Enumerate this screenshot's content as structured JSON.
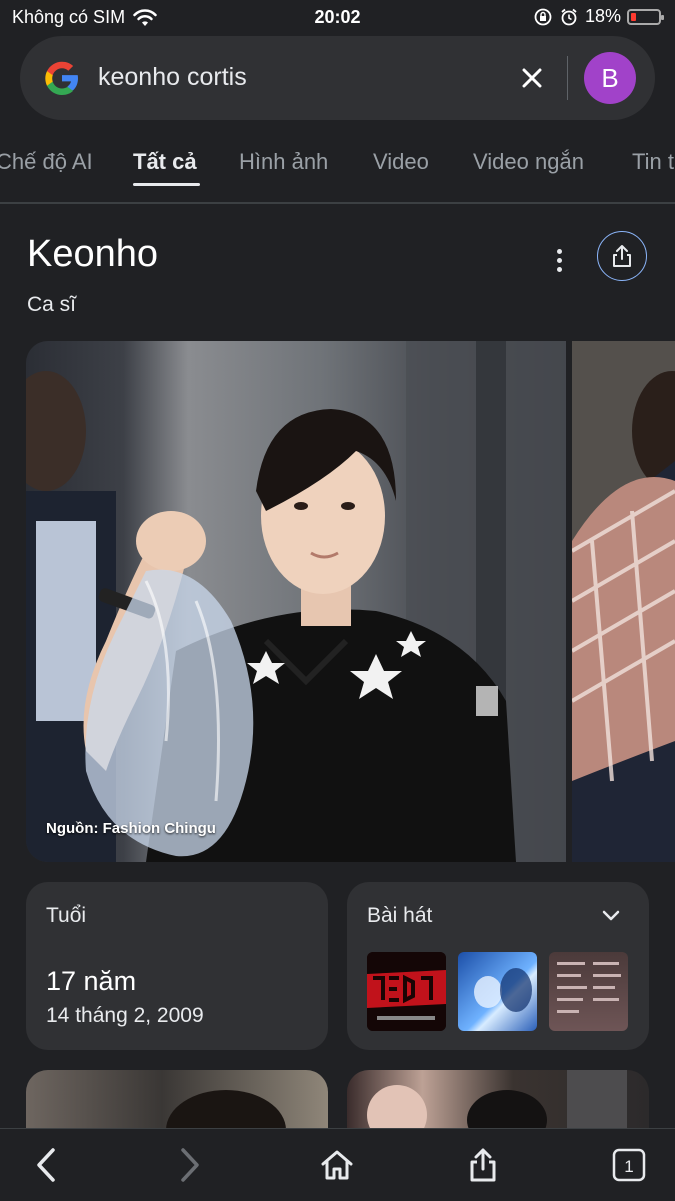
{
  "status_bar": {
    "carrier": "Không có SIM",
    "time": "20:02",
    "battery_percent": "18%",
    "battery_level": 0.18
  },
  "search": {
    "query": "keonho cortis",
    "avatar_letter": "B"
  },
  "tabs": [
    {
      "label": "Chế độ AI",
      "active": false
    },
    {
      "label": "Tất cả",
      "active": true
    },
    {
      "label": "Hình ảnh",
      "active": false
    },
    {
      "label": "Video",
      "active": false
    },
    {
      "label": "Video ngắn",
      "active": false
    },
    {
      "label": "Tin t",
      "active": false
    }
  ],
  "knowledge_panel": {
    "title": "Keonho",
    "subtitle": "Ca sĩ",
    "photo_caption": "Nguồn: Fashion Chingu",
    "age_card": {
      "label": "Tuổi",
      "value": "17 năm",
      "birth_date": "14 tháng 2, 2009"
    },
    "songs_card": {
      "label": "Bài hát"
    }
  },
  "bottom_nav": {
    "tab_count": "1"
  },
  "colors": {
    "background": "#202124",
    "surface": "#303134",
    "accent_blue": "#8ab4f8",
    "avatar": "#a142c9",
    "battery_low": "#ff3b30"
  }
}
